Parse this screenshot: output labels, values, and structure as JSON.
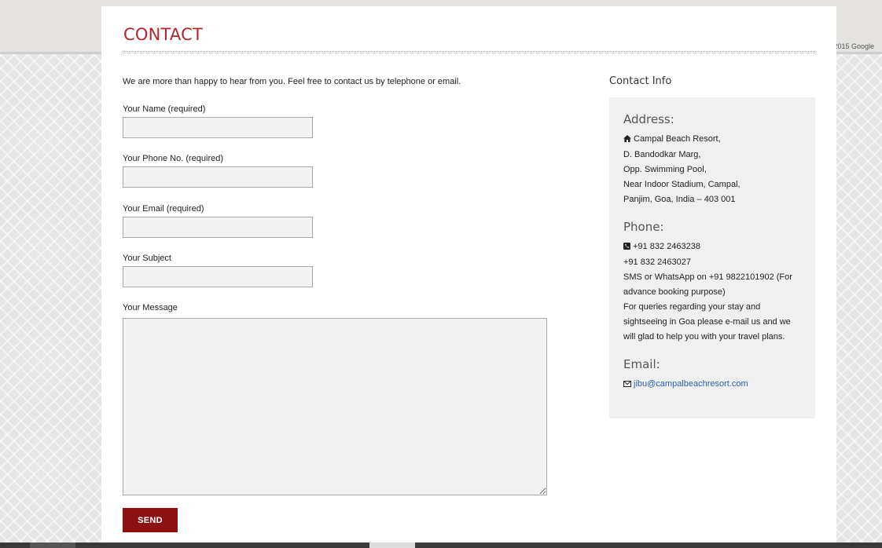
{
  "map": {
    "attribution": "2015 Google"
  },
  "page": {
    "title": "CONTACT",
    "intro": "We are more than happy to hear from you. Feel free to contact us by telephone or email."
  },
  "form": {
    "name_label": "Your Name (required)",
    "phone_label": "Your Phone No. (required)",
    "email_label": "Your Email (required)",
    "subject_label": "Your Subject",
    "message_label": "Your Message",
    "name_value": "",
    "phone_value": "",
    "email_value": "",
    "subject_value": "",
    "message_value": "",
    "send_label": "SEND"
  },
  "contact_info": {
    "title": "Contact Info",
    "address_heading": "Address:",
    "address_lines": [
      "Campal Beach Resort,",
      "D. Bandodkar Marg,",
      "Opp. Swimming Pool,",
      "Near Indoor Stadium, Campal,",
      "Panjim, Goa, India – 403 001"
    ],
    "phone_heading": "Phone:",
    "phone_lines": [
      "+91 832 2463238",
      "+91 832 2463027",
      "SMS or WhatsApp on +91 9822101902 (For advance booking purpose)",
      "For queries regarding your stay and sightseeing in Goa please e-mail us and we will glad to help you with your travel plans."
    ],
    "email_heading": "Email:",
    "email": "jibu@campalbeachresort.com"
  },
  "icons": {
    "address": "home-icon",
    "phone": "phone-icon",
    "email": "envelope-icon"
  },
  "colors": {
    "title": "#b0262b",
    "button": "#8e1111",
    "link": "#2a5db0",
    "info_box": "#f0f0f0",
    "input_bg": "#f3f3f3"
  }
}
